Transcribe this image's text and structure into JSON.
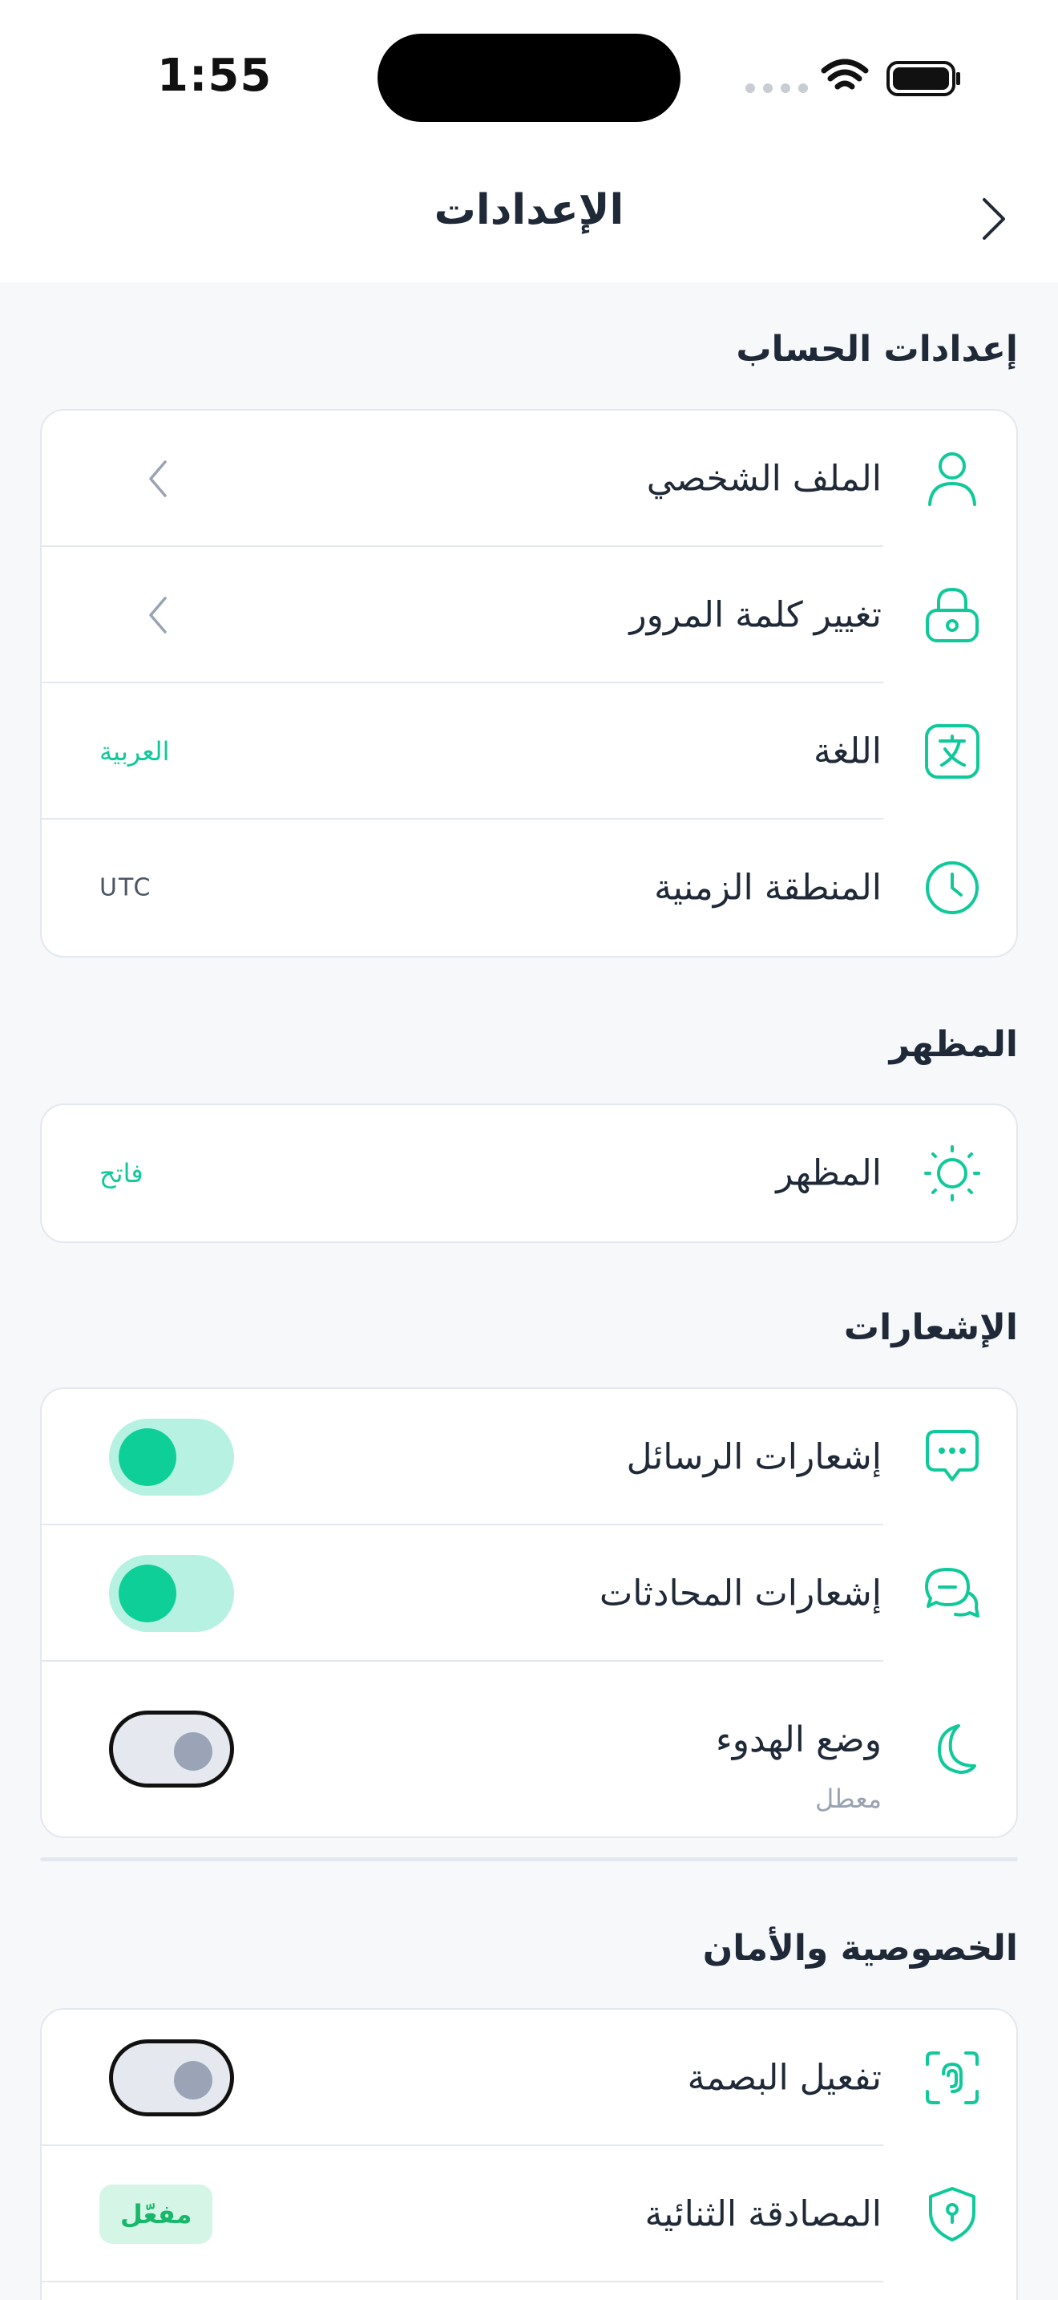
{
  "status_bar": {
    "time": "1:55"
  },
  "header": {
    "title": "الإعدادات"
  },
  "sections": {
    "account": {
      "title": "إعدادات الحساب",
      "profile": {
        "label": "الملف الشخصي"
      },
      "password": {
        "label": "تغيير كلمة المرور"
      },
      "language": {
        "label": "اللغة",
        "value": "العربية"
      },
      "timezone": {
        "label": "المنطقة الزمنية",
        "value": "UTC"
      }
    },
    "appearance": {
      "title": "المظهر",
      "theme": {
        "label": "المظهر",
        "value": "فاتح"
      }
    },
    "notifications": {
      "title": "الإشعارات",
      "messages": {
        "label": "إشعارات الرسائل",
        "enabled": true
      },
      "chats": {
        "label": "إشعارات المحادثات",
        "enabled": true
      },
      "quiet": {
        "label": "وضع الهدوء",
        "sublabel": "معطل",
        "enabled": false
      }
    },
    "privacy": {
      "title": "الخصوصية والأمان",
      "fingerprint": {
        "label": "تفعيل البصمة",
        "enabled": false
      },
      "two_factor": {
        "label": "المصادقة الثنائية",
        "badge": "مفعّل"
      }
    }
  },
  "colors": {
    "accent": "#10c99a",
    "toggle_on": "#0ecf98",
    "badge_bg": "#d5f5e7",
    "badge_text": "#18b86b"
  }
}
